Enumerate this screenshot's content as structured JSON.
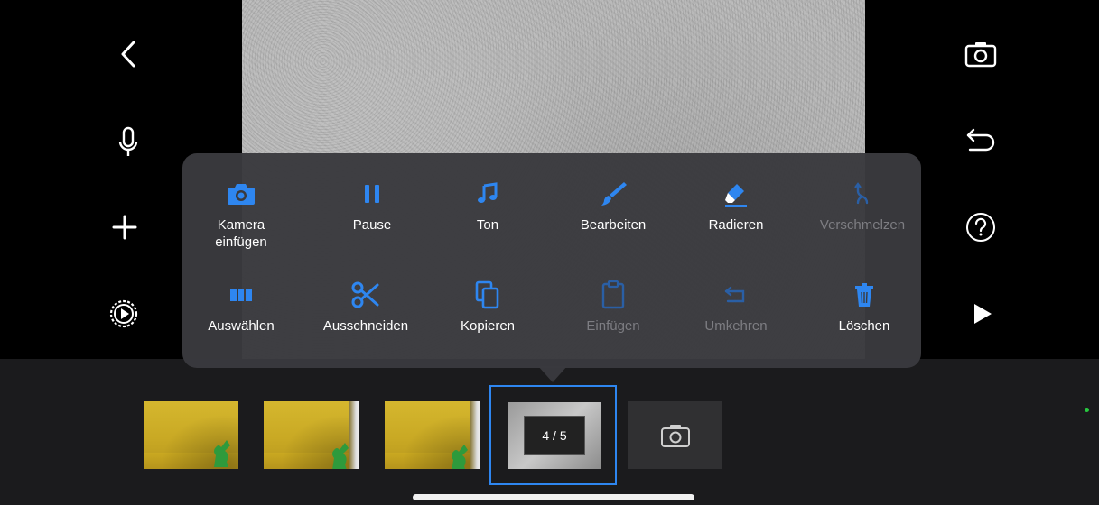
{
  "menu": {
    "row1": [
      {
        "label": "Kamera\neinfügen",
        "icon": "camera-icon",
        "enabled": true
      },
      {
        "label": "Pause",
        "icon": "pause-icon",
        "enabled": true
      },
      {
        "label": "Ton",
        "icon": "music-note-icon",
        "enabled": true
      },
      {
        "label": "Bearbeiten",
        "icon": "brush-icon",
        "enabled": true
      },
      {
        "label": "Radieren",
        "icon": "eraser-icon",
        "enabled": true
      },
      {
        "label": "Verschmelzen",
        "icon": "merge-icon",
        "enabled": false
      }
    ],
    "row2": [
      {
        "label": "Auswählen",
        "icon": "select-icon",
        "enabled": true
      },
      {
        "label": "Ausschneiden",
        "icon": "scissors-icon",
        "enabled": true
      },
      {
        "label": "Kopieren",
        "icon": "copy-icon",
        "enabled": true
      },
      {
        "label": "Einfügen",
        "icon": "clipboard-icon",
        "enabled": false
      },
      {
        "label": "Umkehren",
        "icon": "reverse-icon",
        "enabled": false
      },
      {
        "label": "Löschen",
        "icon": "trash-icon",
        "enabled": true
      }
    ]
  },
  "timeline": {
    "current_frame_label": "4 / 5"
  },
  "colors": {
    "accent": "#2E86F0",
    "popover_bg": "#3A3A3E",
    "disabled_text": "#7D7D82"
  }
}
